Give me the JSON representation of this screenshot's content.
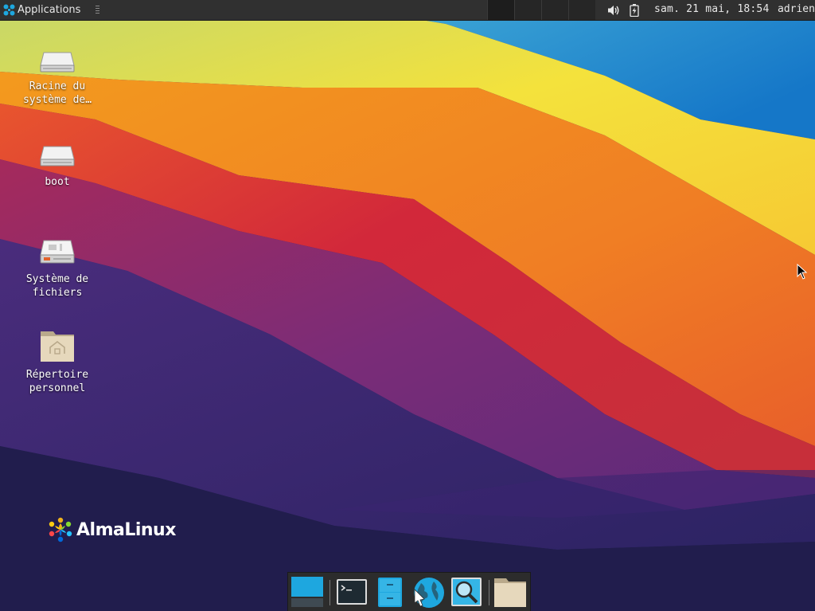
{
  "top_panel": {
    "applications_label": "Applications",
    "clock": "sam. 21 mai, 18:54",
    "user": "adrien"
  },
  "desktop_icons": [
    {
      "label_line1": "Racine du",
      "label_line2": "système de…",
      "icon": "drive-icon"
    },
    {
      "label_line1": "boot",
      "label_line2": "",
      "icon": "drive-icon"
    },
    {
      "label_line1": "Système de",
      "label_line2": "fichiers",
      "icon": "filesystem-drive-icon"
    },
    {
      "label_line1": "Répertoire",
      "label_line2": "personnel",
      "icon": "home-folder-icon"
    }
  ],
  "logo": {
    "text": "AlmaLinux"
  },
  "dock": {
    "items": [
      "show-desktop-icon",
      "terminal-icon",
      "file-manager-icon",
      "web-browser-icon",
      "app-finder-icon",
      "folder-icon"
    ]
  },
  "colors": {
    "panel_bg": "#303030",
    "wallpaper_dark": "#1f1c4f",
    "wallpaper_orange": "#f08a24",
    "wallpaper_yellow": "#f8dd2e",
    "wallpaper_blue": "#1a8ad4",
    "accent_cyan": "#1ea7df"
  }
}
